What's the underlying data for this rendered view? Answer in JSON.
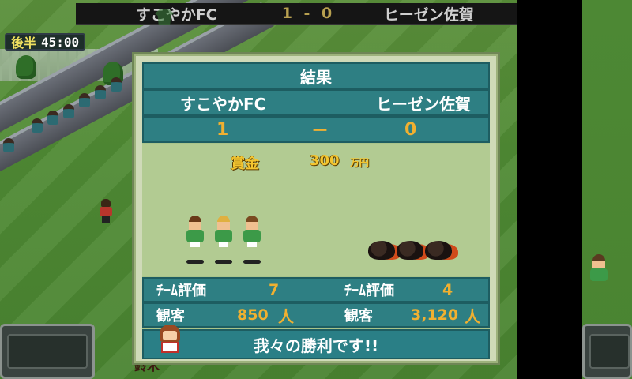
{
  "scoreboard": {
    "home_team": "すこやかFC",
    "score": "1 - 0",
    "away_team": "ヒーゼン佐賀"
  },
  "timer": {
    "half": "後半",
    "time": "45:00"
  },
  "result": {
    "title": "結果",
    "home_team": "すこやかFC",
    "away_team": "ヒーゼン佐賀",
    "home_score": "1",
    "dash": "－",
    "away_score": "0",
    "prize_label": "賞金",
    "prize_value": "300",
    "prize_unit": "万円",
    "home_eval_label": "ﾁｰﾑ評価",
    "home_eval_value": "7",
    "away_eval_label": "ﾁｰﾑ評価",
    "away_eval_value": "4",
    "home_crowd_label": "観客",
    "home_crowd_value": "850",
    "home_crowd_unit": "人",
    "away_crowd_label": "観客",
    "away_crowd_value": "3,120",
    "away_crowd_unit": "人",
    "message": "我々の勝利です!!"
  },
  "bottom": {
    "player_name": "鈴木"
  },
  "colors": {
    "panel_teal": "#2e7f83",
    "score_gold": "#f0b030",
    "prize_gold": "#f3c530",
    "home_jersey": "#3c9a48"
  }
}
